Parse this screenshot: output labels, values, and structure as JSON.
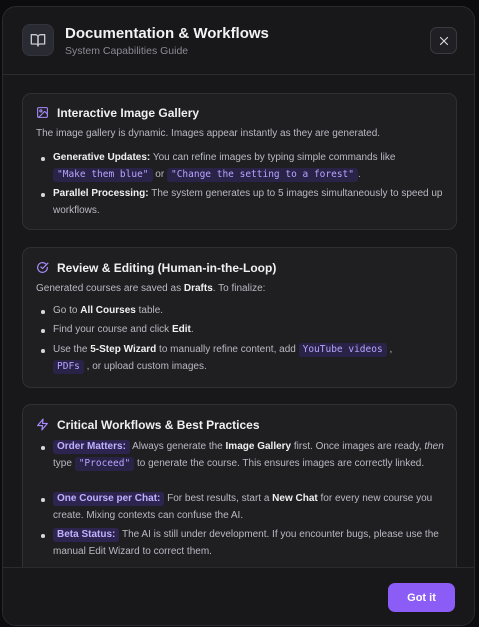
{
  "header": {
    "title": "Documentation & Workflows",
    "subtitle": "System Capabilities Guide"
  },
  "gallery": {
    "title": "Interactive Image Gallery",
    "intro": "The image gallery is dynamic. Images appear instantly as they are generated.",
    "item1_label": "Generative Updates:",
    "item1_text": " You can refine images by typing simple commands like",
    "item1_code1": "\"Make them blue\"",
    "item1_or": " or ",
    "item1_code2": "\"Change the setting to a forest\"",
    "item1_end": ".",
    "item2_label": "Parallel Processing:",
    "item2_text": " The system generates up to 5 images simultaneously to speed up workflows."
  },
  "review": {
    "title": "Review & Editing (Human-in-the-Loop)",
    "intro_a": "Generated courses are saved as ",
    "intro_b": "Drafts",
    "intro_c": ". To finalize:",
    "step1_a": "Go to ",
    "step1_b": "All Courses",
    "step1_c": " table.",
    "step2_a": "Find your course and click ",
    "step2_b": "Edit",
    "step2_c": ".",
    "step3_a": "Use the ",
    "step3_b": "5-Step Wizard",
    "step3_c": " to manually refine content, add ",
    "step3_code1": "YouTube videos",
    "step3_d": " ,",
    "step3_code2": "PDFs",
    "step3_e": " , or upload custom images."
  },
  "critical": {
    "title": "Critical Workflows & Best Practices",
    "i1_tag": "Order Matters:",
    "i1_a": " Always generate the ",
    "i1_b": "Image Gallery",
    "i1_c": " first. Once images are ready, ",
    "i1_d": "then",
    "i1_e": " type ",
    "i1_code": "\"Proceed\"",
    "i1_f": " to generate the course. This ensures images are correctly linked.",
    "i2_tag": "One Course per Chat:",
    "i2_a": " For best results, start a ",
    "i2_b": "New Chat",
    "i2_c": " for every new course you create. Mixing contexts can confuse the AI.",
    "i3_tag": "Beta Status:",
    "i3_a": " The AI is still under development. If you encounter bugs, please use the manual Edit Wizard to correct them."
  },
  "footer": {
    "confirm_label": "Got it"
  },
  "colors": {
    "accent": "#8b5cf6",
    "code_bg": "#2a2348",
    "code_fg": "#b8a4ff"
  },
  "icons": {
    "header": "book-open-icon",
    "close": "close-icon",
    "gallery": "image-icon",
    "review": "check-circle-icon",
    "critical": "zap-icon"
  }
}
